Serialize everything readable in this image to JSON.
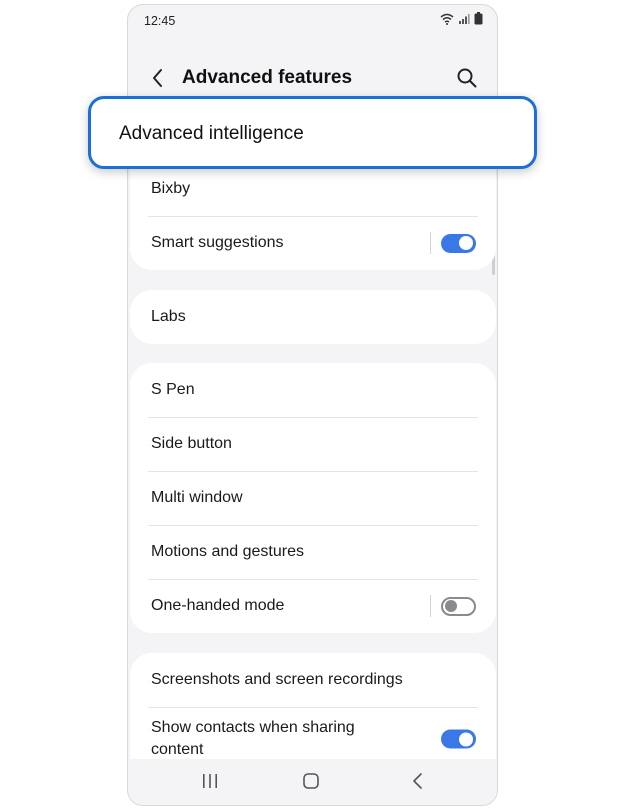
{
  "status_bar": {
    "time": "12:45",
    "icons": [
      "wifi-icon",
      "signal-icon",
      "battery-icon"
    ]
  },
  "app_bar": {
    "title": "Advanced features",
    "back_icon": "back-arrow-icon",
    "search_icon": "search-icon"
  },
  "highlight": {
    "label": "Advanced intelligence",
    "border_color": "#1b6fd6"
  },
  "groups": [
    {
      "items": [
        {
          "label": "Bixby"
        },
        {
          "label": "Smart suggestions",
          "toggle": true
        }
      ]
    },
    {
      "items": [
        {
          "label": "Labs"
        }
      ]
    },
    {
      "items": [
        {
          "label": "S Pen"
        },
        {
          "label": "Side button"
        },
        {
          "label": "Multi window"
        },
        {
          "label": "Motions and gestures"
        },
        {
          "label": "One-handed mode",
          "toggle": false
        }
      ]
    },
    {
      "items": [
        {
          "label": "Screenshots and screen recordings"
        },
        {
          "label": "Show contacts when sharing content",
          "toggle": true
        }
      ]
    }
  ],
  "nav_bar": {
    "icons": [
      "recent-apps-icon",
      "home-icon",
      "back-icon"
    ]
  },
  "colors": {
    "accent": "#3b78e7",
    "background": "#f4f4f6",
    "card": "#ffffff"
  }
}
